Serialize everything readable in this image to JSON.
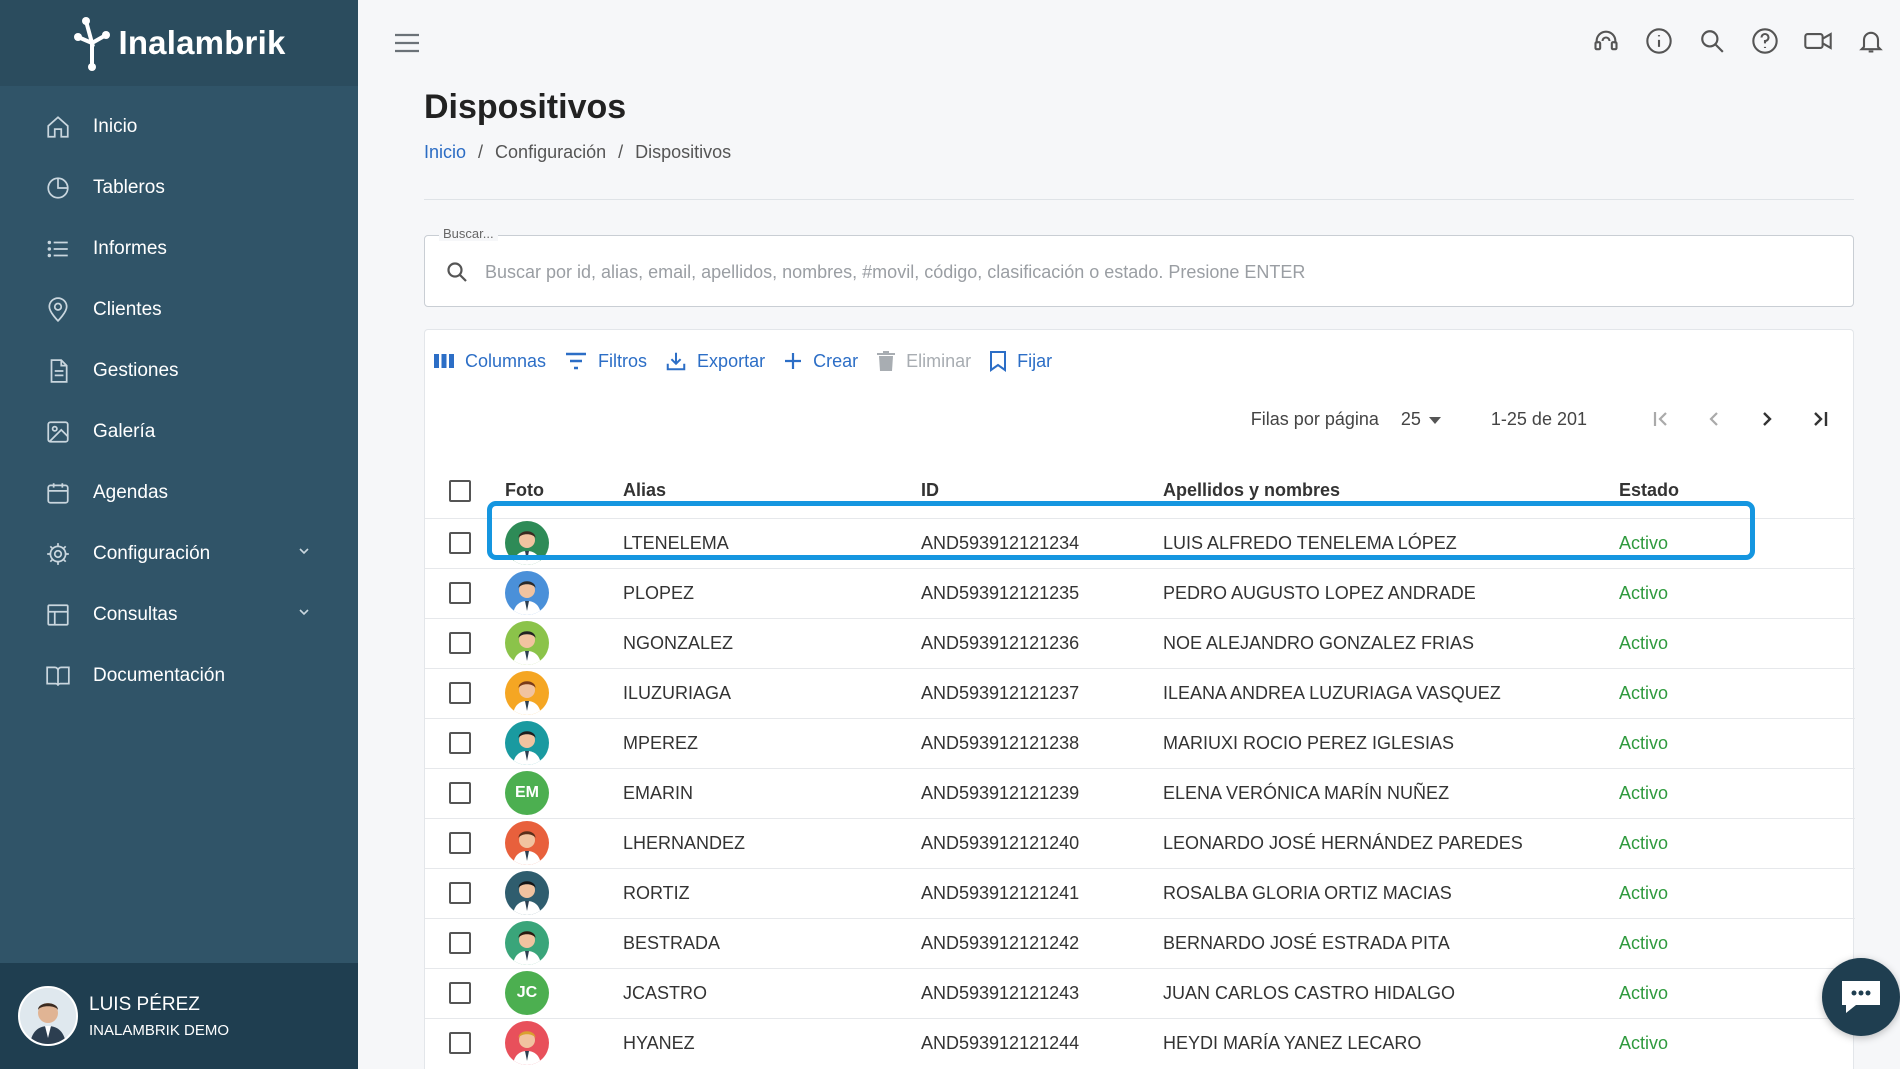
{
  "brand": {
    "name": "Inalambrik",
    "sidebar_color": "#305468",
    "accent": "#2b6cc4",
    "active_color": "#2f9a3e",
    "highlight": "#1596e0"
  },
  "sidebar": {
    "items": [
      {
        "label": "Inicio",
        "icon": "home-icon"
      },
      {
        "label": "Tableros",
        "icon": "pie-chart-icon"
      },
      {
        "label": "Informes",
        "icon": "list-icon"
      },
      {
        "label": "Clientes",
        "icon": "location-pin-icon"
      },
      {
        "label": "Gestiones",
        "icon": "document-icon"
      },
      {
        "label": "Galería",
        "icon": "image-icon"
      },
      {
        "label": "Agendas",
        "icon": "calendar-icon"
      },
      {
        "label": "Configuración",
        "icon": "gear-icon",
        "expandable": true
      },
      {
        "label": "Consultas",
        "icon": "table-icon",
        "expandable": true
      },
      {
        "label": "Documentación",
        "icon": "book-icon"
      }
    ]
  },
  "user": {
    "name": "LUIS PÉREZ",
    "company": "INALAMBRIK DEMO"
  },
  "page": {
    "title": "Dispositivos",
    "breadcrumb": [
      "Inicio",
      "Configuración",
      "Dispositivos"
    ]
  },
  "search": {
    "legend": "Buscar...",
    "placeholder": "Buscar por id, alias, email, apellidos, nombres, #movil, código, clasificación o estado. Presione ENTER"
  },
  "toolbar": {
    "columns": "Columnas",
    "filters": "Filtros",
    "export": "Exportar",
    "create": "Crear",
    "delete": "Eliminar",
    "pin": "Fijar"
  },
  "pagination": {
    "rows_label": "Filas por página",
    "rows_value": "25",
    "range": "1-25 de 201"
  },
  "table": {
    "headers": {
      "foto": "Foto",
      "alias": "Alias",
      "id": "ID",
      "name": "Apellidos y nombres",
      "estado": "Estado"
    },
    "rows": [
      {
        "alias": "LTENELEMA",
        "id": "AND593912121234",
        "name": "LUIS ALFREDO TENELEMA LÓPEZ",
        "estado": "Activo",
        "avatar_bg": "#2e8b57",
        "avatar_hair": "#3a2a20",
        "initials": ""
      },
      {
        "alias": "PLOPEZ",
        "id": "AND593912121235",
        "name": "PEDRO AUGUSTO LOPEZ ANDRADE",
        "estado": "Activo",
        "avatar_bg": "#4a90d9",
        "avatar_hair": "#2a2a2a",
        "initials": ""
      },
      {
        "alias": "NGONZALEZ",
        "id": "AND593912121236",
        "name": "NOE ALEJANDRO GONZALEZ FRIAS",
        "estado": "Activo",
        "avatar_bg": "#8bc34a",
        "avatar_hair": "#222",
        "initials": ""
      },
      {
        "alias": "ILUZURIAGA",
        "id": "AND593912121237",
        "name": "ILEANA ANDREA LUZURIAGA VASQUEZ",
        "estado": "Activo",
        "avatar_bg": "#f5a623",
        "avatar_hair": "#7a3b1a",
        "initials": ""
      },
      {
        "alias": "MPEREZ",
        "id": "AND593912121238",
        "name": "MARIUXI ROCIO PEREZ IGLESIAS",
        "estado": "Activo",
        "avatar_bg": "#1a9aa0",
        "avatar_hair": "#1e1e1e",
        "initials": ""
      },
      {
        "alias": "EMARIN",
        "id": "AND593912121239",
        "name": "ELENA VERÓNICA MARÍN NUÑEZ",
        "estado": "Activo",
        "avatar_bg": "#4caf50",
        "avatar_hair": "",
        "initials": "EM"
      },
      {
        "alias": "LHERNANDEZ",
        "id": "AND593912121240",
        "name": "LEONARDO JOSÉ HERNÁNDEZ PAREDES",
        "estado": "Activo",
        "avatar_bg": "#e8603c",
        "avatar_hair": "#5a2e1a",
        "initials": ""
      },
      {
        "alias": "RORTIZ",
        "id": "AND593912121241",
        "name": "ROSALBA GLORIA ORTIZ MACIAS",
        "estado": "Activo",
        "avatar_bg": "#2f5d6e",
        "avatar_hair": "#151515",
        "initials": ""
      },
      {
        "alias": "BESTRADA",
        "id": "AND593912121242",
        "name": "BERNARDO JOSÉ ESTRADA PITA",
        "estado": "Activo",
        "avatar_bg": "#3aa57a",
        "avatar_hair": "#2a1a10",
        "initials": ""
      },
      {
        "alias": "JCASTRO",
        "id": "AND593912121243",
        "name": "JUAN CARLOS CASTRO HIDALGO",
        "estado": "Activo",
        "avatar_bg": "#4caf50",
        "avatar_hair": "",
        "initials": "JC"
      },
      {
        "alias": "HYANEZ",
        "id": "AND593912121244",
        "name": "HEYDI MARÍA YANEZ LECARO",
        "estado": "Activo",
        "avatar_bg": "#e8505b",
        "avatar_hair": "#d9a030",
        "initials": ""
      }
    ]
  }
}
